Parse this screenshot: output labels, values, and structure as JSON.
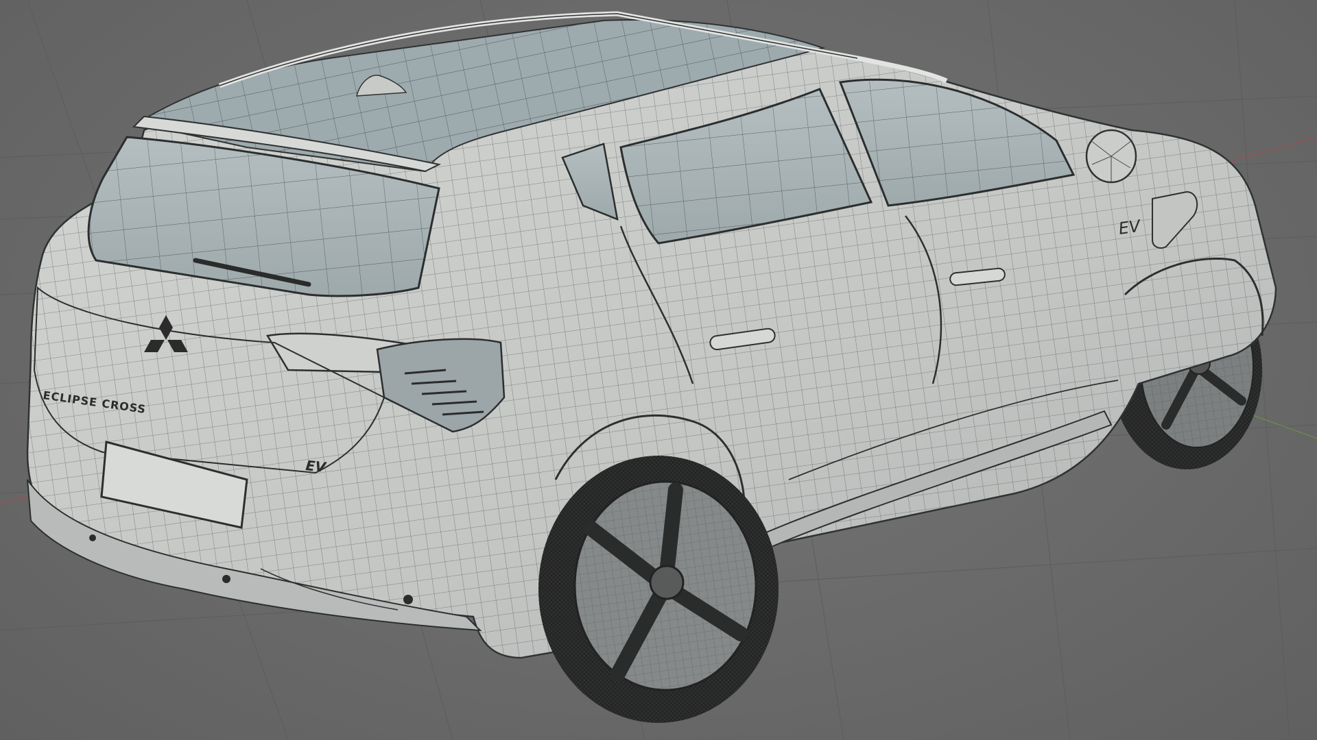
{
  "app": {
    "view": "3d-viewport-wireframe",
    "colors": {
      "background": "#6b6b6b",
      "grid": "#5f5f5f",
      "body": "#c9cbc9",
      "body_shade": "#a9acab",
      "glass": "#a7b3b6",
      "wire": "#3a3d3d",
      "tire": "#2e2f2f",
      "axis_x": "#b0484b",
      "axis_y": "#6d9a3a"
    }
  },
  "car": {
    "rear_badge_text": "ECLIPSE CROSS",
    "ev_badge_rear": "EV",
    "ev_badge_side": "EV"
  },
  "icons": [
    "mitsubishi-logo-icon"
  ]
}
